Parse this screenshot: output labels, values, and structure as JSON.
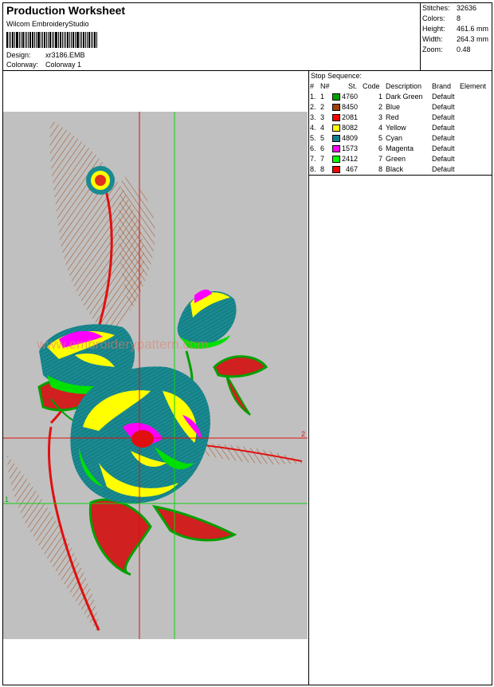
{
  "header": {
    "title": "Production Worksheet",
    "software": "Wilcom EmbroideryStudio",
    "design_label": "Design:",
    "design_value": "xr3186.EMB",
    "colorway_label": "Colorway:",
    "colorway_value": "Colorway 1"
  },
  "stats": [
    {
      "label": "Stitches:",
      "value": "32636"
    },
    {
      "label": "Colors:",
      "value": "8"
    },
    {
      "label": "Height:",
      "value": "461.6 mm"
    },
    {
      "label": "Width:",
      "value": "264.3 mm"
    },
    {
      "label": "Zoom:",
      "value": "0.48"
    }
  ],
  "stop_sequence": {
    "title": "Stop Sequence:",
    "headers": {
      "num": "#",
      "nnum": "N#",
      "st": "St.",
      "code": "Code",
      "desc": "Description",
      "brand": "Brand",
      "element": "Element"
    },
    "rows": [
      {
        "num": "1.",
        "nnum": "1",
        "color": "#00a000",
        "st": "4760",
        "code": "1",
        "desc": "Dark Green",
        "brand": "Default"
      },
      {
        "num": "2.",
        "nnum": "2",
        "color": "#a04000",
        "st": "8450",
        "code": "2",
        "desc": "Blue",
        "brand": "Default"
      },
      {
        "num": "3.",
        "nnum": "3",
        "color": "#ff0000",
        "st": "2081",
        "code": "3",
        "desc": "Red",
        "brand": "Default"
      },
      {
        "num": "4.",
        "nnum": "4",
        "color": "#ffff00",
        "st": "8082",
        "code": "4",
        "desc": "Yellow",
        "brand": "Default"
      },
      {
        "num": "5.",
        "nnum": "5",
        "color": "#108090",
        "st": "4809",
        "code": "5",
        "desc": "Cyan",
        "brand": "Default"
      },
      {
        "num": "6.",
        "nnum": "6",
        "color": "#ff00ff",
        "st": "1573",
        "code": "6",
        "desc": "Magenta",
        "brand": "Default"
      },
      {
        "num": "7.",
        "nnum": "7",
        "color": "#00ff00",
        "st": "2412",
        "code": "7",
        "desc": "Green",
        "brand": "Default"
      },
      {
        "num": "8.",
        "nnum": "8",
        "color": "#ff0000",
        "st": "467",
        "code": "8",
        "desc": "Black",
        "brand": "Default"
      }
    ]
  },
  "canvas": {
    "watermark": "www.embroiderypattern.com",
    "guide_label_1": "1",
    "guide_label_2": "2",
    "background": "#c0c0c0"
  }
}
